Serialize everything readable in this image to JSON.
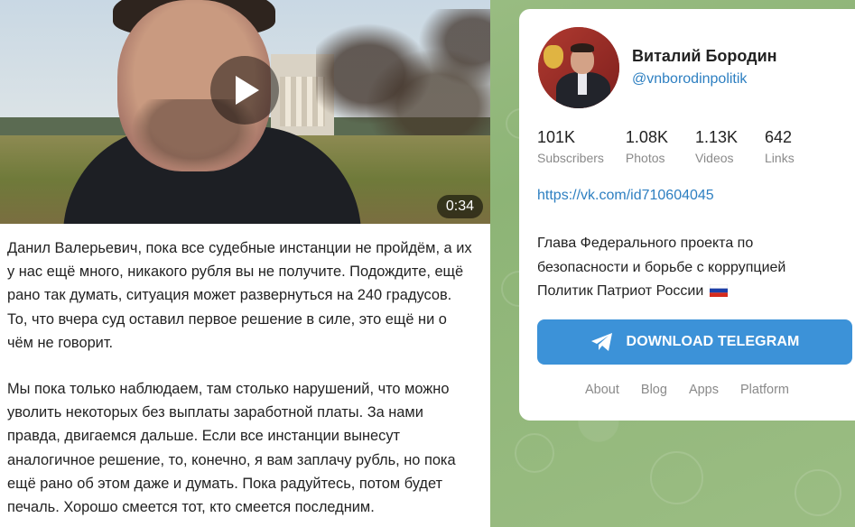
{
  "message": {
    "video": {
      "duration": "0:34"
    },
    "paragraphs": [
      "Данил Валерьевич, пока все судебные инстанции не пройдём, а их у нас ещё много, никакого рубля вы не получите. Подождите, ещё рано так думать, ситуация может развернуться на 240 градусов. То, что вчера суд оставил первое решение в силе, это ещё ни о чём не говорит.",
      "Мы пока только наблюдаем, там столько нарушений, что можно уволить некоторых без выплаты заработной платы. За нами правда, двигаемся дальше. Если все инстанции вынесут аналогичное решение, то, конечно, я вам заплачу рубль, но пока ещё рано об этом даже и думать. Пока радуйтесь, потом будет печаль. Хорошо смеется тот, кто смеется последним."
    ]
  },
  "channel": {
    "title": "Виталий Бородин",
    "handle": "@vnborodinpolitik",
    "stats": [
      {
        "value": "101K",
        "label": "Subscribers"
      },
      {
        "value": "1.08K",
        "label": "Photos"
      },
      {
        "value": "1.13K",
        "label": "Videos"
      },
      {
        "value": "642",
        "label": "Links"
      }
    ],
    "link": "https://vk.com/id710604045",
    "description": "Глава Федерального проекта по безопасности и борьбе с коррупцией Политик Патриот России",
    "flag_icon": "russian-flag-icon",
    "download_label": "DOWNLOAD TELEGRAM",
    "footer_links": [
      "About",
      "Blog",
      "Apps",
      "Platform"
    ]
  },
  "colors": {
    "accent": "#3c92d8",
    "link": "#2d7fc1",
    "background": "#8fb37a"
  }
}
